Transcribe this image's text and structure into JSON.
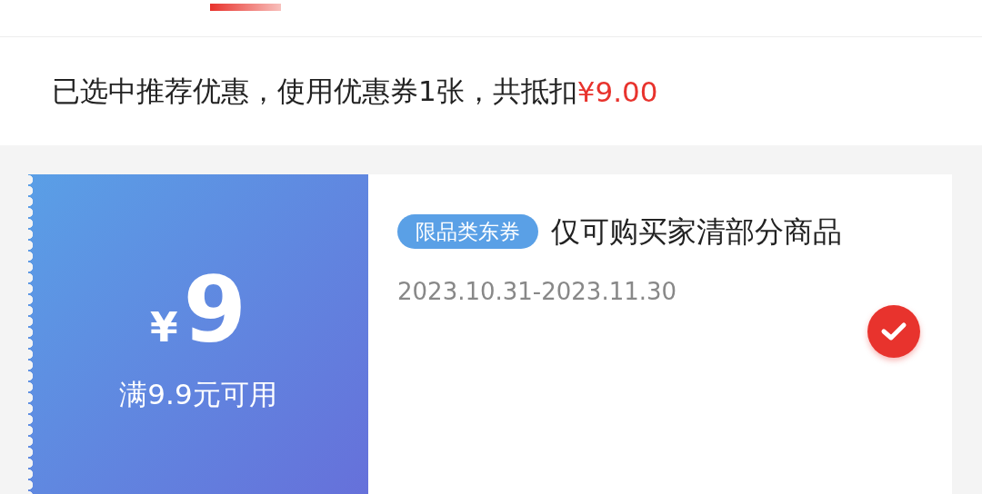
{
  "summary": {
    "text": "已选中推荐优惠，使用优惠券1张，共抵扣",
    "amount": "¥9.00"
  },
  "coupon": {
    "currency": "¥",
    "value": "9",
    "condition": "满9.9元可用",
    "tag": "限品类东券",
    "title": "仅可购买家清部分商品",
    "validity": "2023.10.31-2023.11.30",
    "selected": true
  }
}
